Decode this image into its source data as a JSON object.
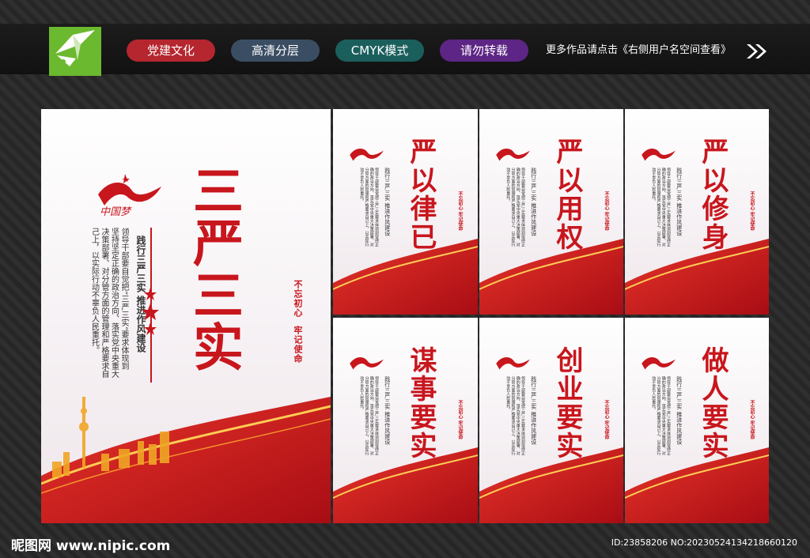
{
  "top_bar": {
    "tags": [
      {
        "label": "党建文化",
        "color": "#b5262e"
      },
      {
        "label": "高清分层",
        "color": "#3a4d63"
      },
      {
        "label": "CMYK模式",
        "color": "#1b5f5d"
      },
      {
        "label": "请勿转载",
        "color": "#5d2585"
      }
    ],
    "notice": "更多作品请点击《右侧用户名空间查看》"
  },
  "main_panel": {
    "title": "三严三实",
    "subtitle": "践行三严三实 推进作风建设",
    "body": "领导干部要自觉把“三严三实”要求体现到坚持坚定正确的政治方向、落实党中央重大决策部署、对分管方面的管理和严格要求自己上，以实际行动不辜负人民重托。",
    "seal": [
      "不忘初心",
      "牢记使命"
    ],
    "accent": "#c8161d"
  },
  "small_panels": [
    {
      "title": "严以律已"
    },
    {
      "title": "严以用权"
    },
    {
      "title": "严以修身"
    },
    {
      "title": "谋事要实"
    },
    {
      "title": "创业要实"
    },
    {
      "title": "做人要实"
    }
  ],
  "small_common": {
    "subtitle": "践行三严三实 推进作风建设",
    "body": "领导干部要自觉把三严三实要求体现到坚持正确的政治方向、落实党中央重大决策部署、对分管方面的管理和严格要求自己上，以实际行动不辜负人民重托。",
    "seal": "不忘初心 牢记使命"
  },
  "footer": {
    "site": "昵图网 www.nipic.com",
    "id": "ID:23858206 NO:20230524134218660120"
  }
}
